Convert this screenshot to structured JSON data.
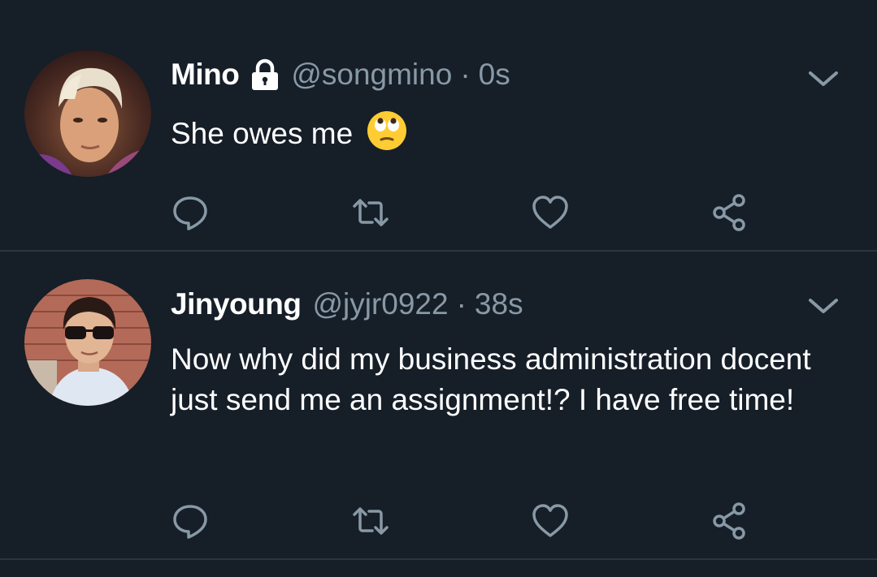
{
  "tweets": [
    {
      "display_name": "Mino",
      "handle": "@songmino",
      "separator": "·",
      "time": "0s",
      "text": "She owes me",
      "protected_icon": "lock-icon",
      "emoji_icon": "face-with-rolling-eyes-emoji"
    },
    {
      "display_name": "Jinyoung",
      "handle": "@jyjr0922",
      "separator": "·",
      "time": "38s",
      "text": "Now why did my business administration docent just send me an assignment!? I have free time!"
    }
  ],
  "colors": {
    "background": "#161e28",
    "secondary_text": "#8899a6",
    "divider": "#2a3542",
    "primary_text": "#ffffff"
  }
}
